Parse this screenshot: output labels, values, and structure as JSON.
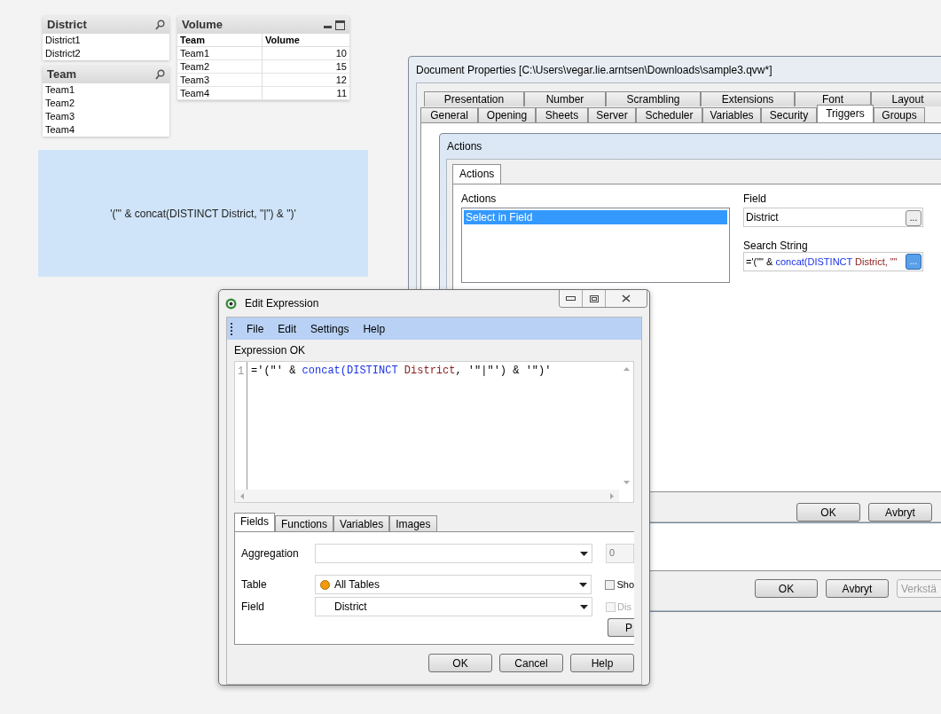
{
  "sheet": {
    "listboxes": [
      {
        "title": "District",
        "items": [
          "District1",
          "District2"
        ]
      },
      {
        "title": "Team",
        "items": [
          "Team1",
          "Team2",
          "Team3",
          "Team4"
        ]
      }
    ],
    "table": {
      "title": "Volume",
      "columns": [
        "Team",
        "Volume"
      ],
      "rows": [
        [
          "Team1",
          "10"
        ],
        [
          "Team2",
          "15"
        ],
        [
          "Team3",
          "12"
        ],
        [
          "Team4",
          "11"
        ]
      ]
    },
    "text_object": {
      "text": "'(\"' & concat(DISTINCT District, \"|\") & \")'"
    }
  },
  "document_properties": {
    "title": "Document Properties [C:\\Users\\vegar.lie.arntsen\\Downloads\\sample3.qvw*]",
    "tab_rows": [
      [
        {
          "label": "Presentation",
          "selected": false
        },
        {
          "label": "Number",
          "selected": false
        },
        {
          "label": "Scrambling",
          "selected": false
        },
        {
          "label": "Extensions",
          "selected": false
        },
        {
          "label": "Font",
          "selected": false
        },
        {
          "label": "Layout",
          "selected": false
        }
      ],
      [
        {
          "label": "General",
          "selected": false
        },
        {
          "label": "Opening",
          "selected": false
        },
        {
          "label": "Sheets",
          "selected": false
        },
        {
          "label": "Server",
          "selected": false
        },
        {
          "label": "Scheduler",
          "selected": false
        },
        {
          "label": "Variables",
          "selected": false
        },
        {
          "label": "Security",
          "selected": false
        },
        {
          "label": "Triggers",
          "selected": true
        },
        {
          "label": "Groups",
          "selected": false
        }
      ]
    ],
    "buttons": [
      {
        "label": "OK",
        "disabled": false
      },
      {
        "label": "Avbryt",
        "disabled": false
      },
      {
        "label": "Verkstä",
        "disabled": true
      }
    ]
  },
  "actions_dialog": {
    "title": "Actions",
    "tab": "Actions",
    "actions_label": "Actions",
    "actions": [
      {
        "label": "Select in Field",
        "selected": true
      }
    ],
    "field_label": "Field",
    "field_value": "District",
    "browse_button": "...",
    "search_label": "Search String",
    "search_tokens": [
      {
        "text": "='(\"\" & ",
        "kind": "plain"
      },
      {
        "text": "concat(DISTINCT ",
        "kind": "function"
      },
      {
        "text": "District, \"\"",
        "kind": "field"
      }
    ],
    "search_button": "...",
    "buttons": [
      "OK",
      "Avbryt"
    ]
  },
  "edit_expression": {
    "title": "Edit Expression",
    "menu": [
      "File",
      "Edit",
      "Settings",
      "Help"
    ],
    "status": "Expression OK",
    "line_number": "1",
    "tokens": [
      {
        "text": "='(\"' & ",
        "kind": "plain"
      },
      {
        "text": "concat(DISTINCT ",
        "kind": "function"
      },
      {
        "text": "District",
        "kind": "field"
      },
      {
        "text": ", '\"|\"') & '\")'",
        "kind": "plain"
      }
    ],
    "tabs": [
      {
        "label": "Fields",
        "selected": true
      },
      {
        "label": "Functions",
        "selected": false
      },
      {
        "label": "Variables",
        "selected": false
      },
      {
        "label": "Images",
        "selected": false
      }
    ],
    "aggregation_label": "Aggregation",
    "table_label": "Table",
    "table_value": "All Tables",
    "field_label": "Field",
    "field_value": "District",
    "count_value": "0",
    "checkboxes": [
      {
        "label": "Sho",
        "checked": false,
        "disabled": false
      },
      {
        "label": "Dis",
        "checked": false,
        "disabled": true
      }
    ],
    "side_button": "P",
    "buttons": [
      "OK",
      "Cancel",
      "Help"
    ]
  }
}
